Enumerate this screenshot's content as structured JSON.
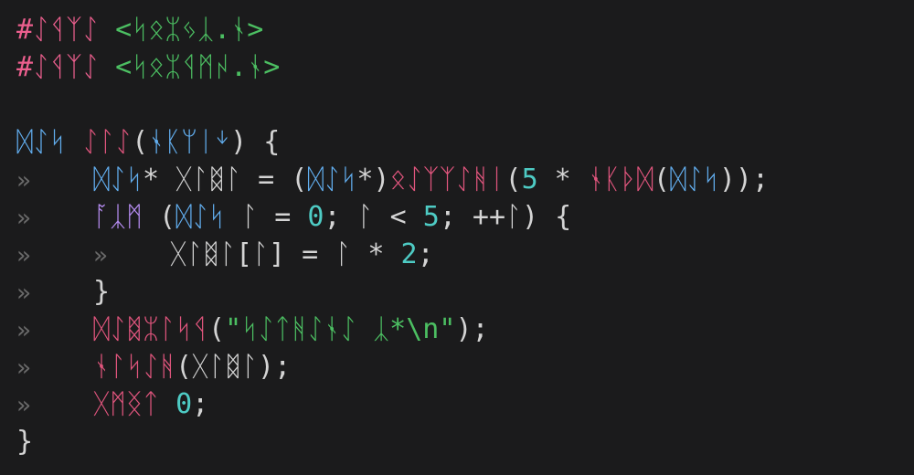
{
  "theme": {
    "background": "#1b1b1c",
    "indent_guide_glyph": "»",
    "colors": {
      "default": "#d4d4d4",
      "keyword": "#62aeef",
      "preproc": "#ec5f8e",
      "function": "#e0557d",
      "string": "#4cbf62",
      "number": "#4ecbc4",
      "control": "#b58cf0",
      "guide": "#6a6a6a"
    }
  },
  "code_lines": [
    {
      "indent": 0,
      "tokens": [
        {
          "t": "#ᛇᛩᛉᛇ ",
          "c": "preproc"
        },
        {
          "t": "<ᛋᛟᛯᛃᛣ.ᛀ>",
          "c": "string"
        }
      ]
    },
    {
      "indent": 0,
      "tokens": [
        {
          "t": "#ᛇᛩᛉᛇ ",
          "c": "preproc"
        },
        {
          "t": "<ᛋᛟᛯᛩᛗᛲ.ᛀ>",
          "c": "string"
        }
      ]
    },
    {
      "indent": 0,
      "tokens": []
    },
    {
      "indent": 0,
      "tokens": [
        {
          "t": "ᛞᛇᛋ ",
          "c": "keyword"
        },
        {
          "t": "ᛇᛚᛇ",
          "c": "function"
        },
        {
          "t": "(",
          "c": "default"
        },
        {
          "t": "ᛀᛕᛘᛁᛎ",
          "c": "keyword"
        },
        {
          "t": ") {",
          "c": "default"
        }
      ]
    },
    {
      "indent": 1,
      "tokens": [
        {
          "t": "ᛞᛇᛋ",
          "c": "keyword"
        },
        {
          "t": "* ᚷᛚᛥᛚ = (",
          "c": "default"
        },
        {
          "t": "ᛞᛇᛋ",
          "c": "keyword"
        },
        {
          "t": "*)",
          "c": "default"
        },
        {
          "t": "ᛟᛇᛉᛉᛇᚻᛁ",
          "c": "function"
        },
        {
          "t": "(",
          "c": "default"
        },
        {
          "t": "5",
          "c": "number"
        },
        {
          "t": " * ",
          "c": "default"
        },
        {
          "t": "ᛀᛕᚦᛞ",
          "c": "function"
        },
        {
          "t": "(",
          "c": "default"
        },
        {
          "t": "ᛞᛇᛋ",
          "c": "keyword"
        },
        {
          "t": "));",
          "c": "default"
        }
      ]
    },
    {
      "indent": 1,
      "tokens": [
        {
          "t": "ᚪᛣᛗ",
          "c": "control"
        },
        {
          "t": " (",
          "c": "default"
        },
        {
          "t": "ᛞᛇᛋ",
          "c": "keyword"
        },
        {
          "t": " ᛚ = ",
          "c": "default"
        },
        {
          "t": "0",
          "c": "number"
        },
        {
          "t": "; ᛚ < ",
          "c": "default"
        },
        {
          "t": "5",
          "c": "number"
        },
        {
          "t": "; ++ᛚ) {",
          "c": "default"
        }
      ]
    },
    {
      "indent": 2,
      "tokens": [
        {
          "t": "ᚷᛚᛥᛚ[ᛚ] = ᛚ * ",
          "c": "default"
        },
        {
          "t": "2",
          "c": "number"
        },
        {
          "t": ";",
          "c": "default"
        }
      ]
    },
    {
      "indent": 1,
      "tokens": [
        {
          "t": "}",
          "c": "default"
        }
      ]
    },
    {
      "indent": 1,
      "tokens": [
        {
          "t": "ᛞᛇᛥᛯᛚᛋᛩ",
          "c": "function"
        },
        {
          "t": "(",
          "c": "default"
        },
        {
          "t": "\"ᛋᛇᛏᚻᛇᛀᛇ ᛣ*\\n\"",
          "c": "string"
        },
        {
          "t": ");",
          "c": "default"
        }
      ]
    },
    {
      "indent": 1,
      "tokens": [
        {
          "t": "ᛀᛚᛋᛇᚻ",
          "c": "function"
        },
        {
          "t": "(ᚷᛚᛥᛚ);",
          "c": "default"
        }
      ]
    },
    {
      "indent": 1,
      "tokens": [
        {
          "t": "ᚷᛗᛝᛏ",
          "c": "function"
        },
        {
          "t": " ",
          "c": "default"
        },
        {
          "t": "0",
          "c": "number"
        },
        {
          "t": ";",
          "c": "default"
        }
      ]
    },
    {
      "indent": 0,
      "tokens": [
        {
          "t": "}",
          "c": "default"
        }
      ]
    }
  ]
}
